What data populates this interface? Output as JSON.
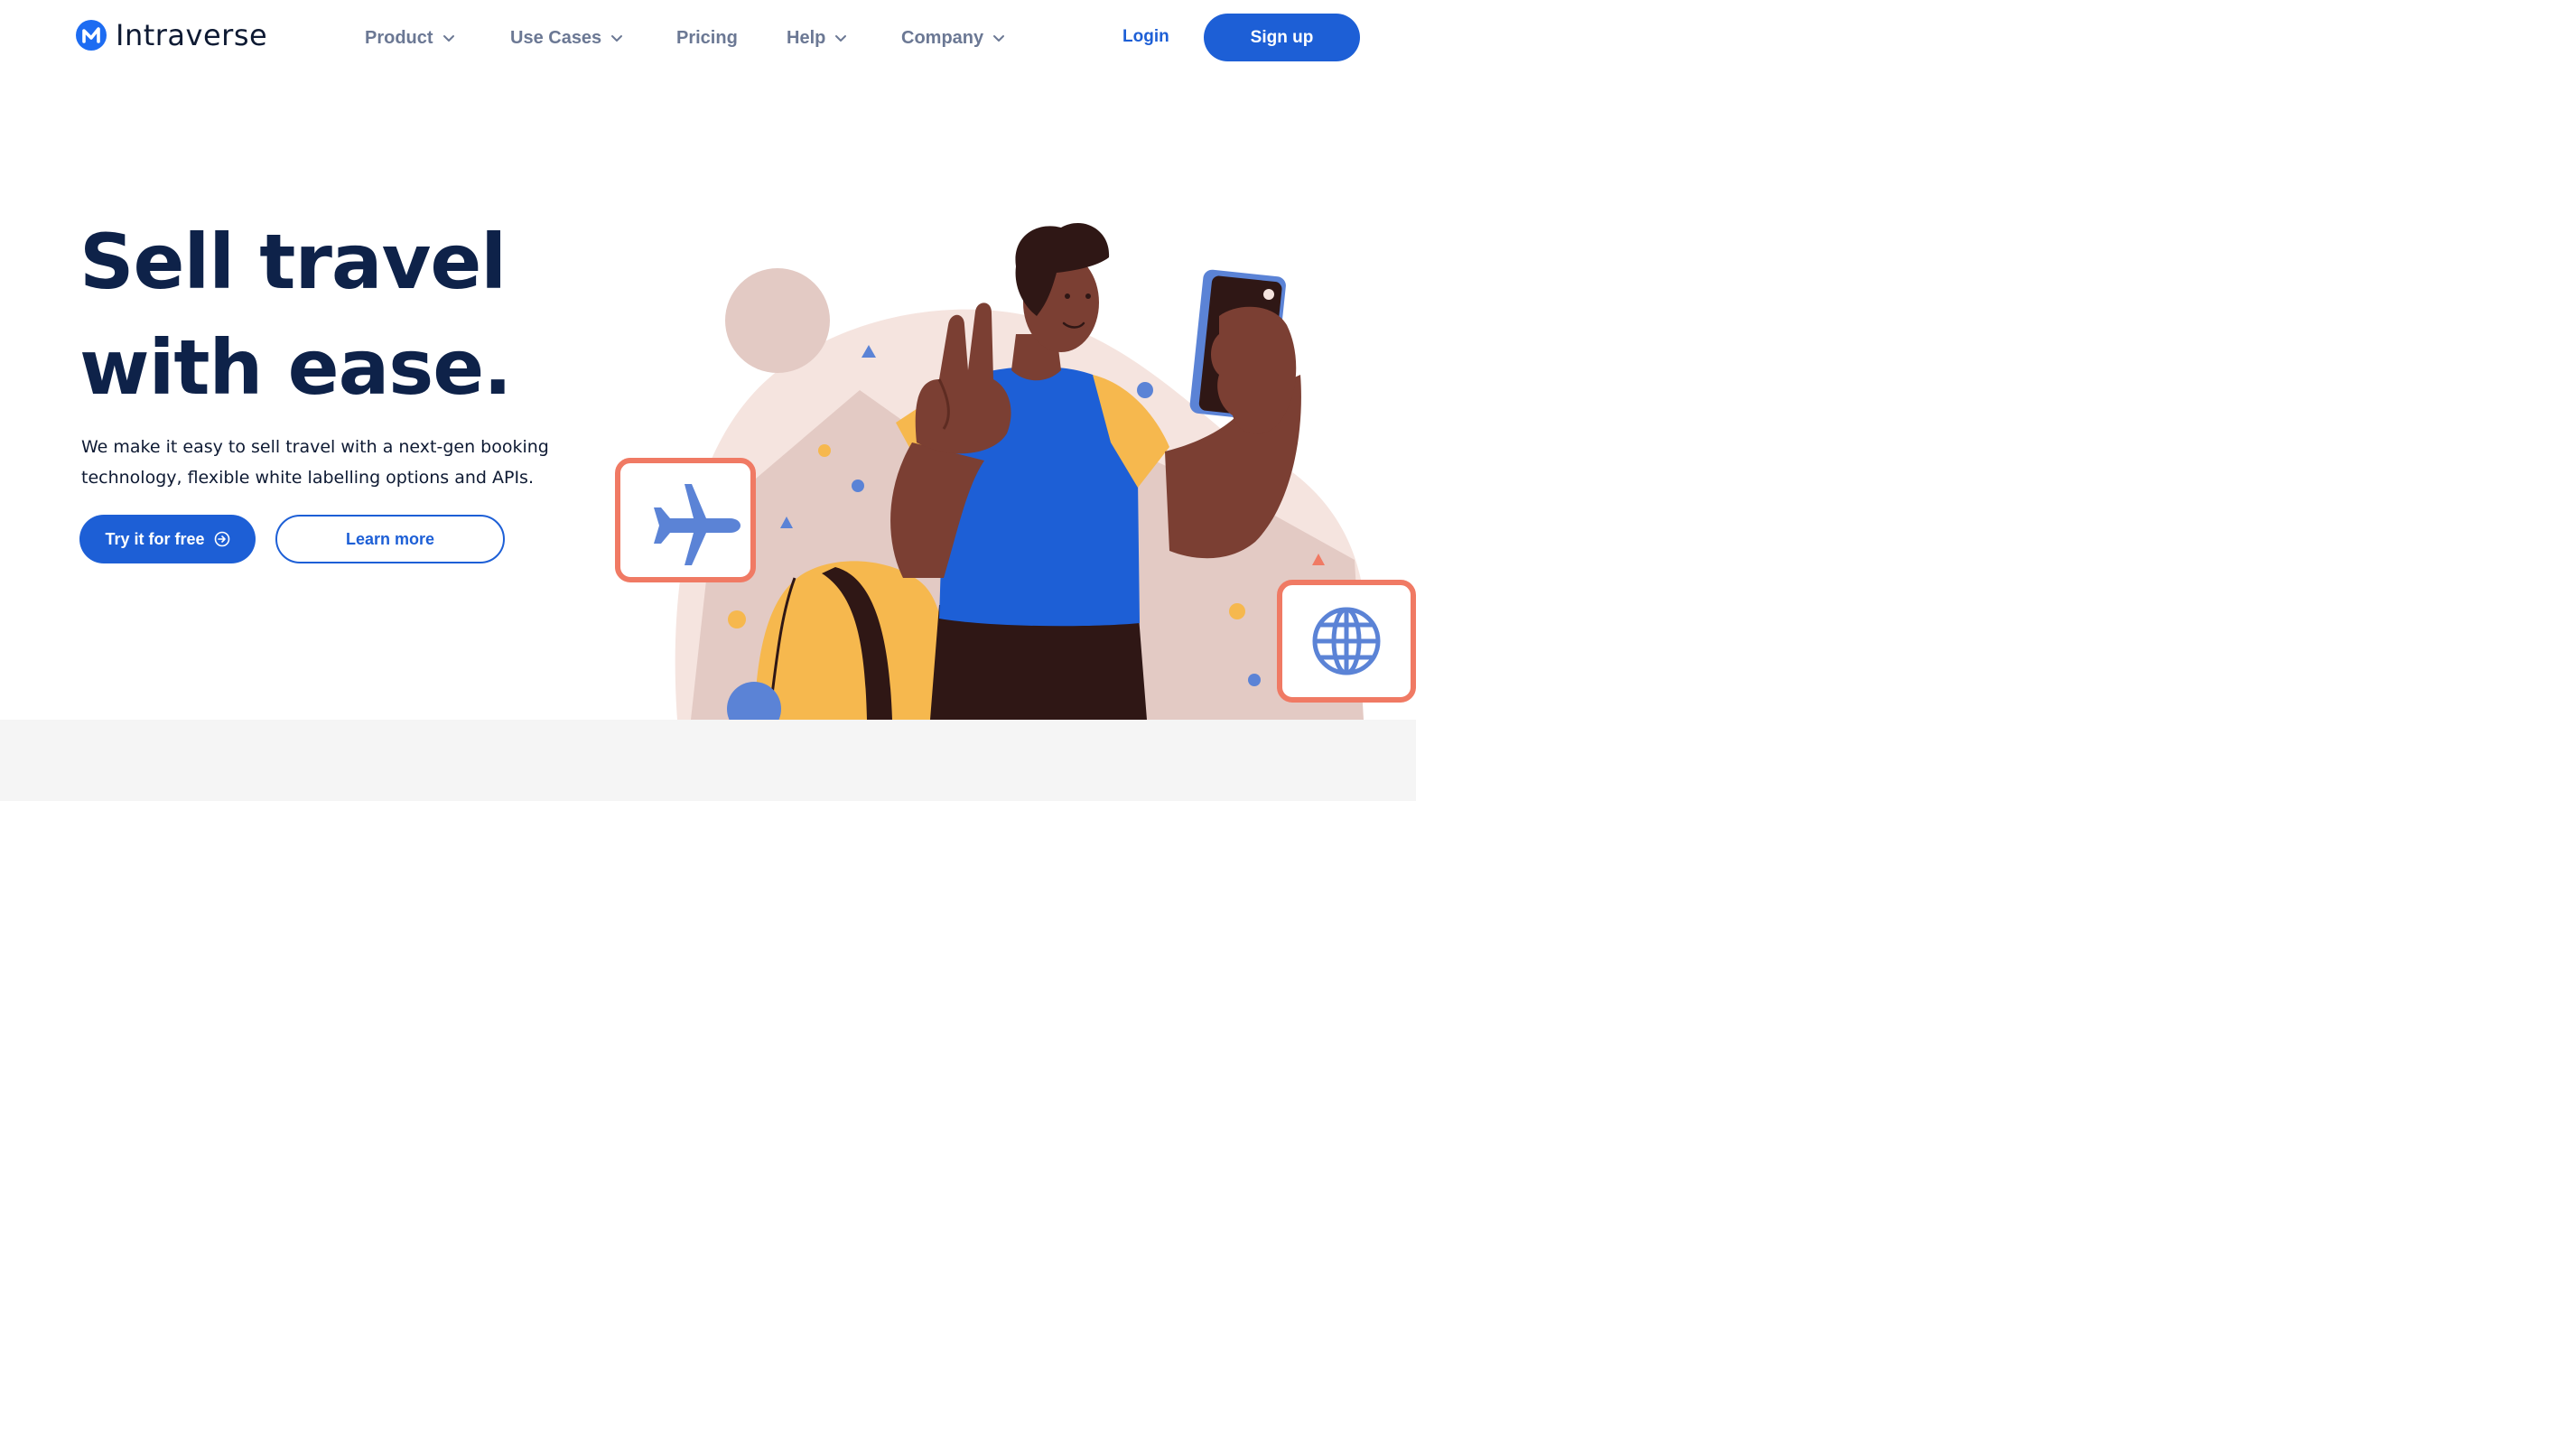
{
  "brand": {
    "name": "Intraverse",
    "accent": "#1d5fd6",
    "text_dark": "#0e2249"
  },
  "nav": {
    "items": [
      {
        "label": "Product",
        "has_dropdown": true
      },
      {
        "label": "Use Cases",
        "has_dropdown": true
      },
      {
        "label": "Pricing",
        "has_dropdown": false
      },
      {
        "label": "Help",
        "has_dropdown": true
      },
      {
        "label": "Company",
        "has_dropdown": true
      }
    ],
    "login_label": "Login",
    "signup_label": "Sign up"
  },
  "hero": {
    "headline_line1": "Sell travel",
    "headline_line2": "with ease.",
    "subtitle": "We make it easy to sell travel with a next-gen booking technology, flexible white labelling options and APIs.",
    "primary_cta": "Try it for free",
    "secondary_cta": "Learn more",
    "illustration_icons": [
      "airplane-icon",
      "globe-icon"
    ]
  }
}
